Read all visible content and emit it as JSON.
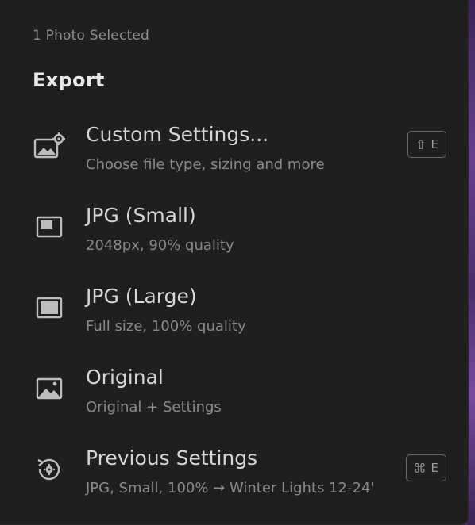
{
  "header": {
    "selected_count": "1 Photo Selected",
    "title": "Export"
  },
  "menu": {
    "items": [
      {
        "label": "Custom Settings...",
        "sublabel": "Choose file type, sizing and more",
        "icon": "image-settings-icon",
        "shortcut": {
          "modifier": "⇧",
          "key": "E"
        }
      },
      {
        "label": "JPG (Small)",
        "sublabel": "2048px, 90% quality",
        "icon": "small-frame-icon"
      },
      {
        "label": "JPG (Large)",
        "sublabel": "Full size, 100% quality",
        "icon": "large-frame-icon"
      },
      {
        "label": "Original",
        "sublabel": "Original + Settings",
        "icon": "image-icon"
      },
      {
        "label": "Previous Settings",
        "sublabel": "JPG, Small, 100% → Winter Lights 12-24'",
        "icon": "history-settings-icon",
        "shortcut": {
          "modifier": "⌘",
          "key": "E"
        }
      }
    ]
  },
  "colors": {
    "panel_bg": "#1f1f1f",
    "text_primary": "#d6d6d6",
    "text_secondary": "#8a8a8a"
  }
}
